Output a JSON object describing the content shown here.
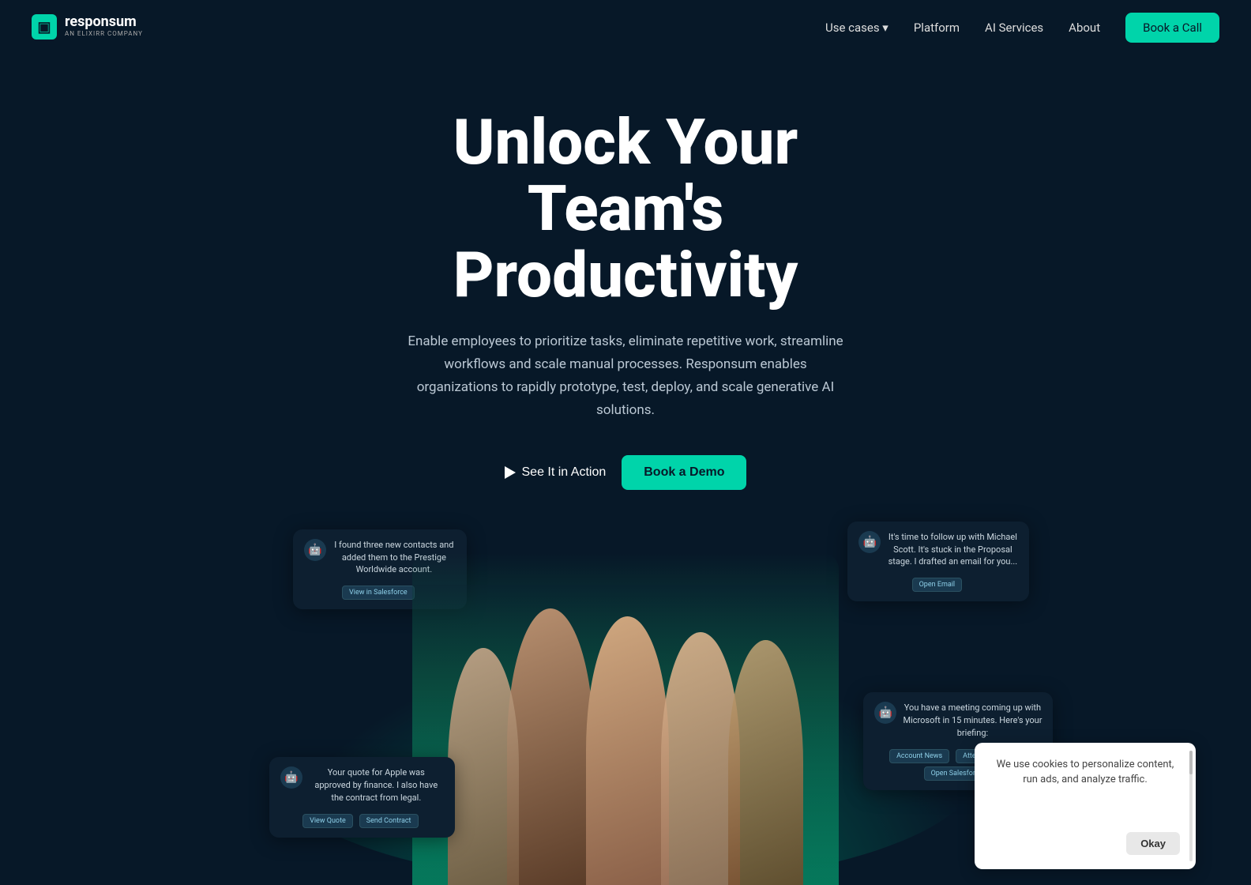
{
  "nav": {
    "logo_icon": "▣",
    "logo_name": "responsum",
    "logo_sub": "AN ELIXIRR COMPANY",
    "links": [
      {
        "id": "use-cases",
        "label": "Use cases ▾"
      },
      {
        "id": "platform",
        "label": "Platform"
      },
      {
        "id": "ai-services",
        "label": "AI Services"
      },
      {
        "id": "about",
        "label": "About"
      }
    ],
    "cta_label": "Book a Call"
  },
  "hero": {
    "headline_line1": "Unlock Your",
    "headline_line2": "Team's Productivity",
    "description": "Enable employees to prioritize tasks, eliminate repetitive work, streamline workflows and scale manual processes. Responsum enables organizations to rapidly prototype, test, deploy, and scale generative AI solutions.",
    "btn_action_label": "See It in Action",
    "btn_demo_label": "Book a Demo"
  },
  "bubbles": [
    {
      "id": "bubble-1",
      "text": "I found three new contacts and added them to the Prestige Worldwide account.",
      "btn_labels": [
        "View in Salesforce"
      ]
    },
    {
      "id": "bubble-2",
      "text": "It's time to follow up with Michael Scott. It's stuck in the Proposal stage. I drafted an email for you...",
      "btn_labels": [
        "Open Email"
      ]
    },
    {
      "id": "bubble-3",
      "text": "You have a meeting coming up with Microsoft in 15 minutes. Here's your briefing:",
      "btn_labels": [
        "Account News",
        "Attendee Profiles",
        "Open Salesforce"
      ]
    },
    {
      "id": "bubble-4",
      "text": "Your quote for Apple was approved by finance. I also have the contract from legal.",
      "btn_labels": [
        "View Quote",
        "Send Contract"
      ]
    }
  ],
  "cookie": {
    "text": "We use cookies to personalize content, run ads, and analyze traffic.",
    "btn_label": "Okay"
  },
  "colors": {
    "accent": "#00d4aa",
    "bg_dark": "#071828",
    "bg_bubble": "#0d1f30"
  }
}
